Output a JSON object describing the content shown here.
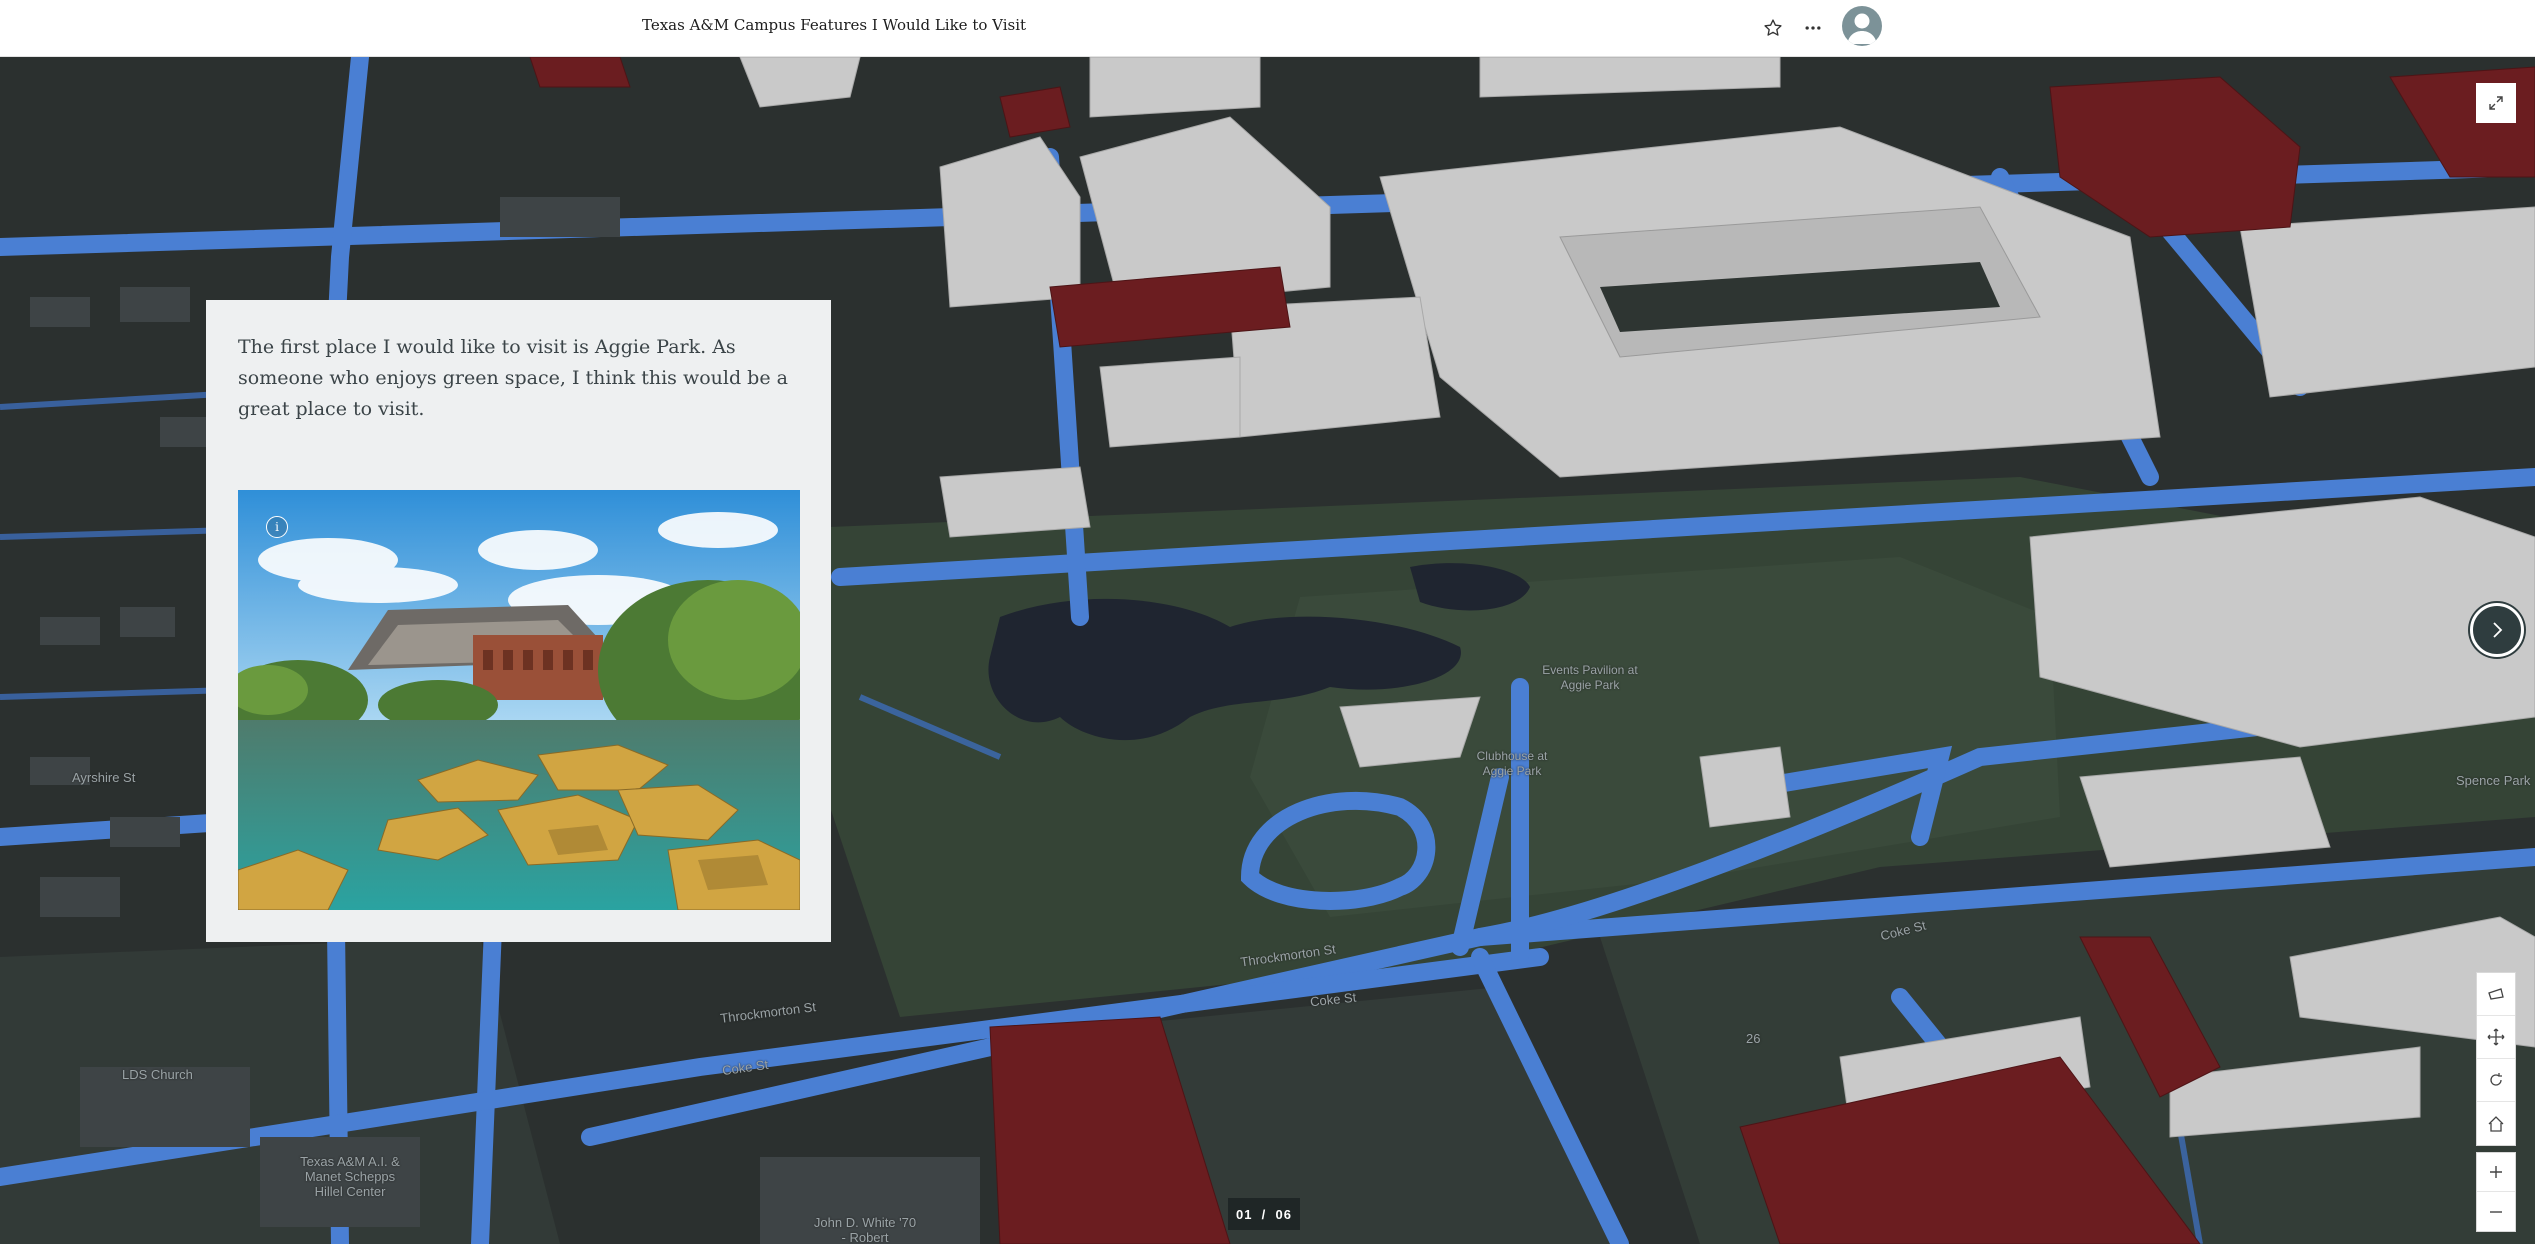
{
  "header": {
    "title": "Texas A&M Campus Features I Would Like to Visit",
    "favorite_icon": "star-icon",
    "more_icon": "more-horizontal-icon",
    "avatar_icon": "user-avatar-icon"
  },
  "panel": {
    "text": "The first place I would like to visit is Aggie Park. As someone who enjoys green space, I think this would be a great place to visit.",
    "info_label": "i"
  },
  "map_labels": {
    "ayrshire": "Ayrshire St",
    "lds_church": "LDS Church",
    "hillel": "Texas A&M A.I. & Manet Schepps Hillel Center",
    "john_white": "John D. White '70 - Robert",
    "throckmorton_1": "Throckmorton St",
    "throckmorton_2": "Throckmorton St",
    "coke_1": "Coke St",
    "coke_2": "Coke St",
    "coke_3": "Coke St",
    "spence": "Spence Park",
    "pavilion": "Events Pavilion at Aggie Park",
    "aggie_park": "Clubhouse at Aggie Park",
    "lot_26": "26"
  },
  "controls": {
    "expand_icon": "expand-icon",
    "next_icon": "chevron-right-icon",
    "tools": [
      "tilt-icon",
      "pan-icon",
      "rotate-icon",
      "home-icon",
      "zoom-in-icon",
      "zoom-out-icon"
    ]
  },
  "pagination": {
    "label": "01  /  06"
  },
  "colors": {
    "ground": "#2b302f",
    "grass": "#354436",
    "roads": "#4a7fd3",
    "buildings": "#c9c9c9",
    "maroon_buildings": "#6b1d20",
    "water": "#1f2530",
    "panel_bg": "#eef0f1"
  }
}
